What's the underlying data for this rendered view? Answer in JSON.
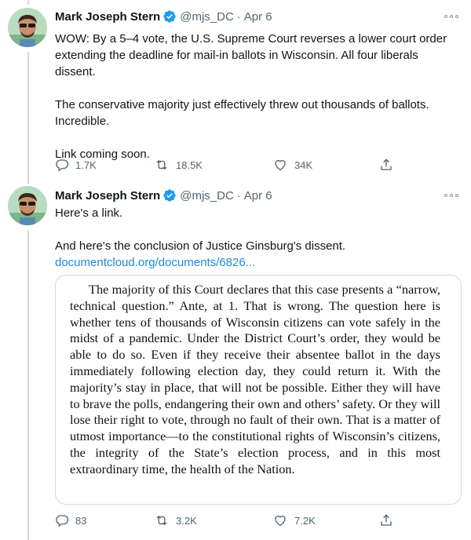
{
  "tweets": [
    {
      "author": "Mark Joseph Stern",
      "handle": "@mjs_DC",
      "separator": "·",
      "date": "Apr 6",
      "paragraphs": [
        "WOW: By a 5–4 vote, the U.S. Supreme Court reverses a lower court order extending the deadline for mail-in ballots in Wisconsin. All four liberals dissent.",
        "The conservative majority just effectively threw out thousands of ballots. Incredible.",
        "Link coming soon."
      ],
      "replies": "1.7K",
      "retweets": "18.5K",
      "likes": "34K"
    },
    {
      "author": "Mark Joseph Stern",
      "handle": "@mjs_DC",
      "separator": "·",
      "date": "Apr 6",
      "paragraphs": [
        "Here's a link.",
        "And here's the conclusion of Justice Ginsburg's dissent."
      ],
      "link": "documentcloud.org/documents/6826...",
      "document_excerpt": "The majority of this Court declares that this case presents a “narrow, technical question.” Ante, at 1. That is wrong. The question here is whether tens of thousands of Wisconsin citizens can vote safely in the midst of a pandemic. Under the District Court’s order, they would be able to do so. Even if they receive their absentee ballot in the days immediately following election day, they could return it. With the majority’s stay in place, that will not be possible. Either they will have to brave the polls, endangering their own and others’ safety. Or they will lose their right to vote, through no fault of their own. That is a matter of utmost importance—to the constitutional rights of Wisconsin’s citizens, the integrity of the State’s election process, and in this most extraordinary time, the health of the Nation.",
      "replies": "83",
      "retweets": "3.2K",
      "likes": "7.2K"
    }
  ],
  "colors": {
    "text": "#0f1419",
    "secondary": "#536471",
    "link": "#1d8ad6",
    "verified": "#1d9bf0",
    "border": "#cfd9de"
  },
  "icons": [
    "avatar",
    "verified-badge-icon",
    "more-options-icon",
    "reply-icon",
    "retweet-icon",
    "like-icon",
    "share-icon"
  ]
}
